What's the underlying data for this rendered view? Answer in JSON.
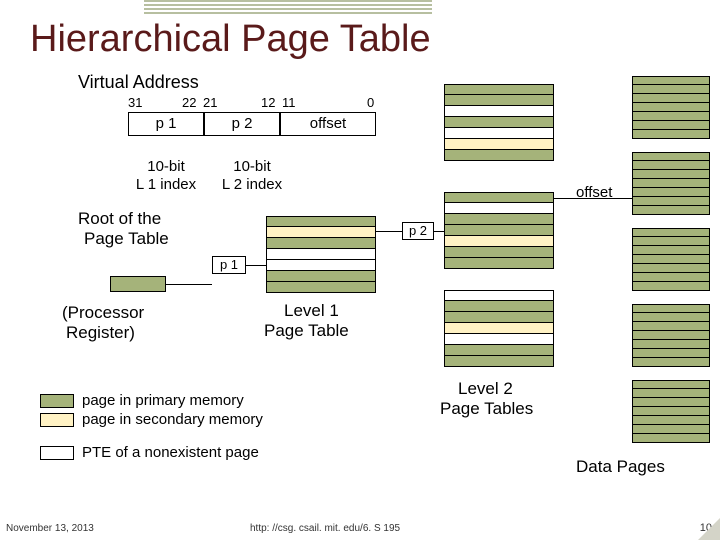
{
  "title": "Hierarchical Page Table",
  "subtitle": "Virtual Address",
  "bits": {
    "b31": "31",
    "b22": "22",
    "b21": "21",
    "b12": "12",
    "b11": "11",
    "b0": "0"
  },
  "fields": {
    "p1": "p 1",
    "p2": "p 2",
    "offset": "offset"
  },
  "idx": {
    "l1a": "10-bit",
    "l1b": "L 1 index",
    "l2a": "10-bit",
    "l2b": "L 2 index"
  },
  "root": {
    "a": "Root of the",
    "b": "Page Table"
  },
  "proc": {
    "a": "(Processor",
    "b": "Register)"
  },
  "ptr": {
    "p1": "p 1",
    "p2": "p 2",
    "offset": "offset"
  },
  "captions": {
    "l1": "Level 1",
    "l1b": "Page Table",
    "l2": "Level 2",
    "l2b": "Page Tables",
    "data": "Data Pages"
  },
  "legend": {
    "prim": "page in primary memory",
    "sec": "page in secondary memory",
    "none": "PTE of a nonexistent page"
  },
  "footer": {
    "date": "November 13, 2013",
    "url": "http: //csg. csail. mit. edu/6. S 195",
    "page": "10"
  }
}
